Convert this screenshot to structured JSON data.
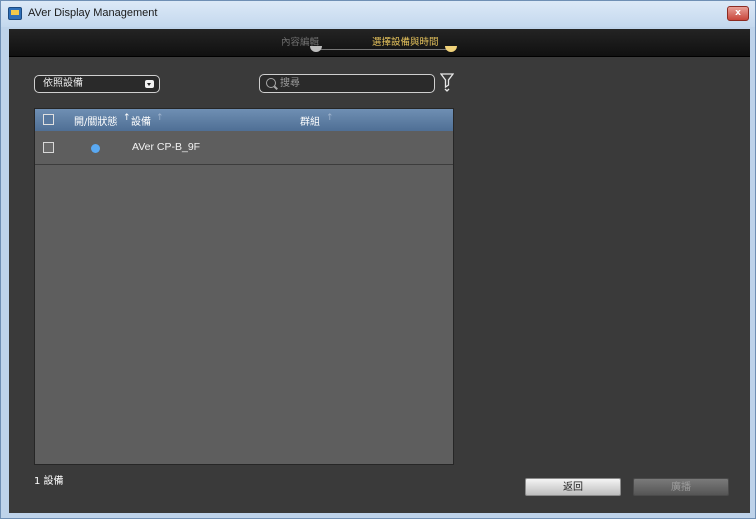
{
  "window": {
    "title": "AVer Display Management",
    "close_label": "x"
  },
  "steps": {
    "items": [
      {
        "label": "內容編輯",
        "state": "inactive"
      },
      {
        "label": "選擇設備與時間",
        "state": "active"
      }
    ],
    "active_color": "#e6c35c"
  },
  "filter": {
    "selected": "依照設備"
  },
  "search": {
    "placeholder": "搜尋",
    "value": ""
  },
  "table": {
    "columns": [
      "開/關狀態",
      "設備",
      "群組"
    ],
    "rows": [
      {
        "checked": false,
        "status": "online",
        "status_color": "#5aa9f2",
        "device": "AVer CP-B_9F",
        "group": ""
      }
    ],
    "header_color": "#5f7fa5"
  },
  "footer": {
    "device_count": "1 設備",
    "back_label": "返回",
    "broadcast_label": "廣播"
  },
  "icons": {
    "app": "app-icon",
    "close": "close-icon",
    "search": "search-icon",
    "filter": "filter-icon",
    "sort": "sort-arrow-icon",
    "dropdown": "chevron-down-icon"
  }
}
